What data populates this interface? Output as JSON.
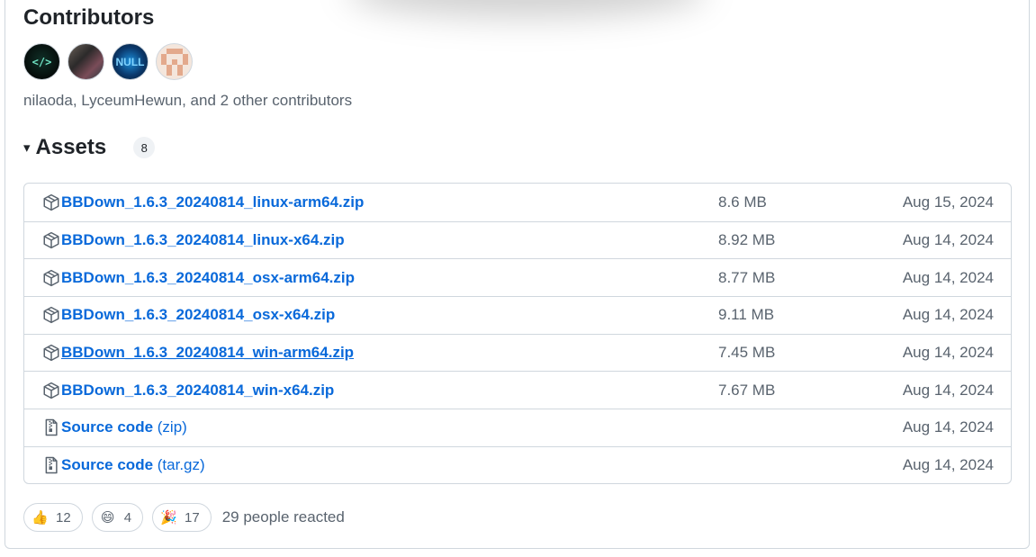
{
  "contributors": {
    "title": "Contributors",
    "avatars": [
      {
        "label": "</>"
      },
      {
        "label": ""
      },
      {
        "label": "NULL"
      },
      {
        "label": ""
      }
    ],
    "summary": "nilaoda, LyceumHewun, and 2 other contributors"
  },
  "assets": {
    "caret": "▾",
    "title": "Assets",
    "count": "8",
    "items": [
      {
        "name": "BBDown_1.6.3_20240814_linux-arm64.zip",
        "suffix": "",
        "size": "8.6 MB",
        "date": "Aug 15, 2024",
        "icon": "package-icon"
      },
      {
        "name": "BBDown_1.6.3_20240814_linux-x64.zip",
        "suffix": "",
        "size": "8.92 MB",
        "date": "Aug 14, 2024",
        "icon": "package-icon"
      },
      {
        "name": "BBDown_1.6.3_20240814_osx-arm64.zip",
        "suffix": "",
        "size": "8.77 MB",
        "date": "Aug 14, 2024",
        "icon": "package-icon"
      },
      {
        "name": "BBDown_1.6.3_20240814_osx-x64.zip",
        "suffix": "",
        "size": "9.11 MB",
        "date": "Aug 14, 2024",
        "icon": "package-icon"
      },
      {
        "name": "BBDown_1.6.3_20240814_win-arm64.zip",
        "suffix": "",
        "size": "7.45 MB",
        "date": "Aug 14, 2024",
        "icon": "package-icon"
      },
      {
        "name": "BBDown_1.6.3_20240814_win-x64.zip",
        "suffix": "",
        "size": "7.67 MB",
        "date": "Aug 14, 2024",
        "icon": "package-icon"
      },
      {
        "name": "Source code",
        "suffix": " (zip)",
        "size": "",
        "date": "Aug 14, 2024",
        "icon": "file-zip-icon"
      },
      {
        "name": "Source code",
        "suffix": " (tar.gz)",
        "size": "",
        "date": "Aug 14, 2024",
        "icon": "file-zip-icon"
      }
    ]
  },
  "reactions": {
    "items": [
      {
        "emoji": "👍",
        "count": "12",
        "icon": "thumbs-up-icon"
      },
      {
        "emoji": "😄",
        "count": "4",
        "icon": "laugh-icon"
      },
      {
        "emoji": "🎉",
        "count": "17",
        "icon": "hooray-icon"
      }
    ],
    "summary": "29 people reacted"
  },
  "colors": {
    "link": "#0969da",
    "muted": "#59636e",
    "border": "#d0d7de"
  }
}
